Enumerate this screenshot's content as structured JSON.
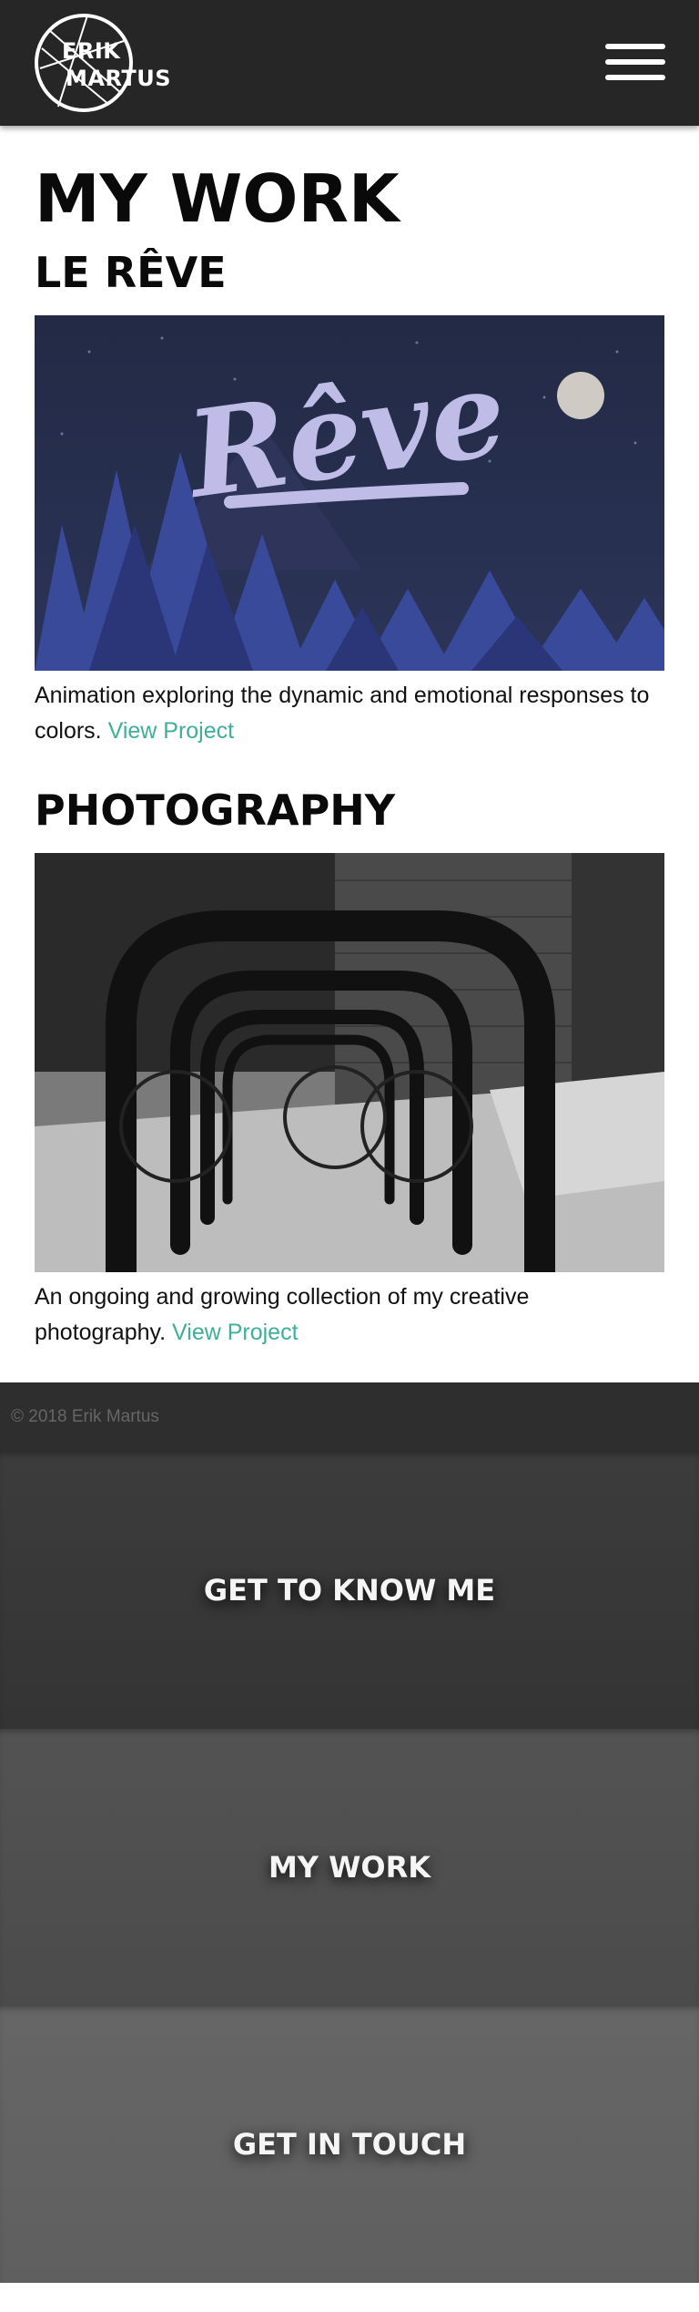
{
  "header": {
    "logo_line1": "ERIK",
    "logo_line2": "MARTUS",
    "menu_icon": "hamburger-menu-icon"
  },
  "main": {
    "title": "MY WORK",
    "projects": [
      {
        "title": "LE RÊVE",
        "image_text": "Rêve",
        "description": "Animation exploring the dynamic and emotional responses to colors.",
        "link": "View Project"
      },
      {
        "title": "PHOTOGRAPHY",
        "description": "An ongoing and growing collection of my creative photography.",
        "link": "View Project"
      }
    ]
  },
  "footer": {
    "copyright": "© 2018 Erik Martus"
  },
  "nav_panels": [
    {
      "label": "GET TO KNOW ME"
    },
    {
      "label": "MY WORK"
    },
    {
      "label": "GET IN TOUCH"
    }
  ],
  "colors": {
    "header_bg": "#262626",
    "link": "#3fae9a",
    "footer_bg": "#2e2e2e"
  }
}
